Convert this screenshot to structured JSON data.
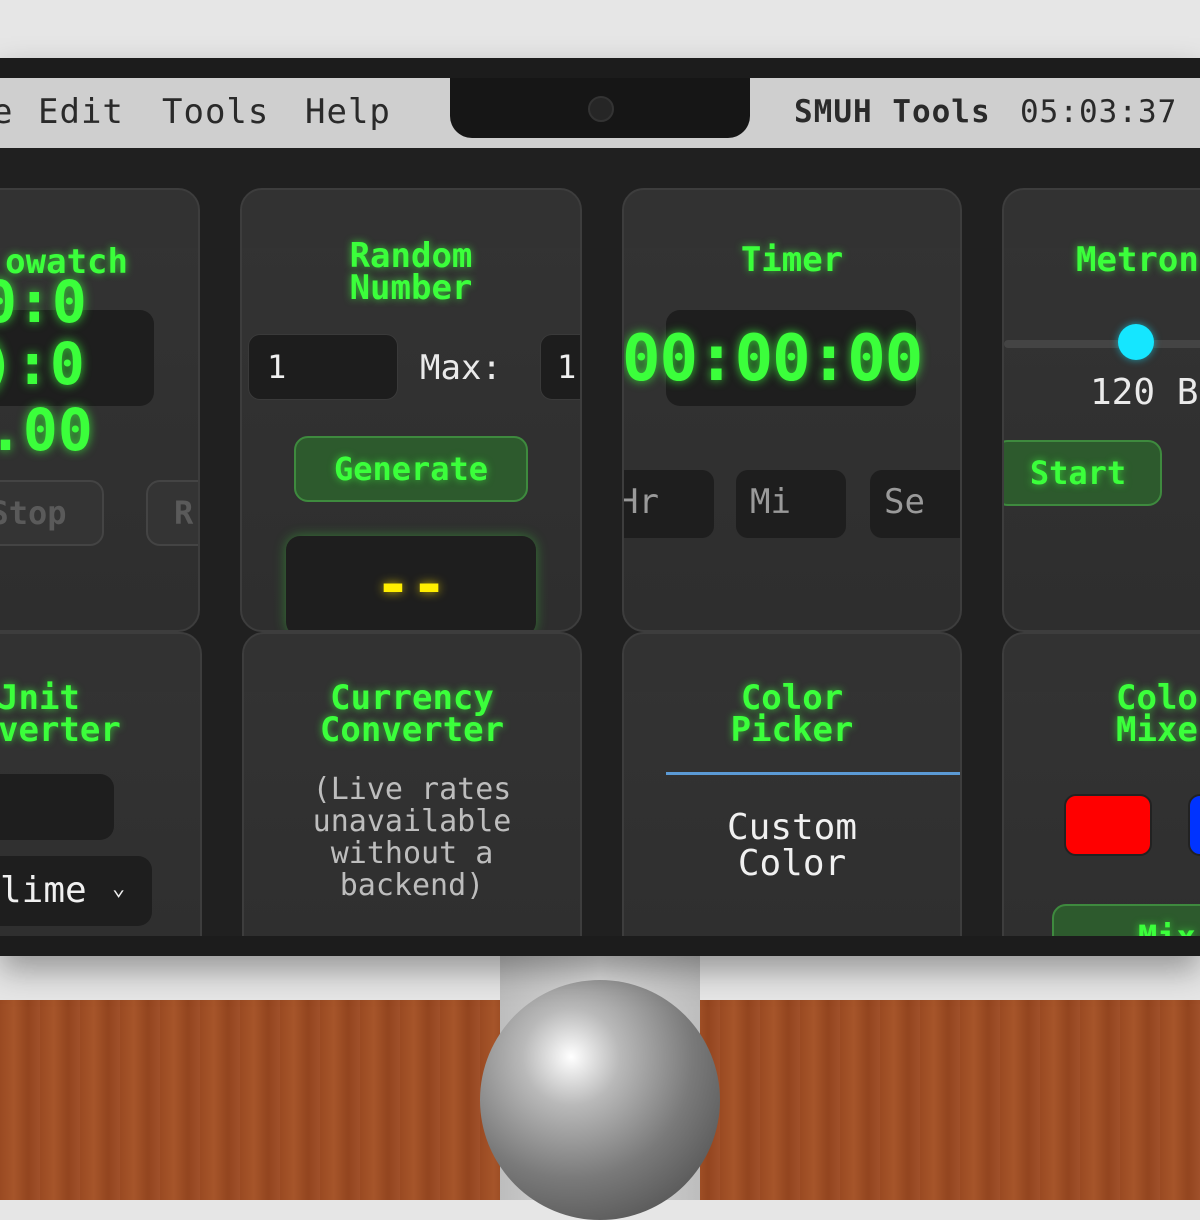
{
  "menubar": {
    "items": [
      "e",
      "Edit",
      "Tools",
      "Help"
    ],
    "brand": "SMUH Tools",
    "clock": "05:03:37"
  },
  "cards": {
    "stopwatch": {
      "title": "owatch",
      "line1": "0:0",
      "line2": "):0",
      "line3": ".00",
      "stop_label": "Stop",
      "reset_label": "R"
    },
    "random": {
      "title_line1": "Random",
      "title_line2": "Number",
      "min_value": "1",
      "max_label": "Max:",
      "max_value": "1",
      "generate_label": "Generate",
      "result": "--"
    },
    "timer": {
      "title": "Timer",
      "display": "00:00:00",
      "hr_placeholder": "Hr",
      "mi_placeholder": "Mi",
      "se_placeholder": "Se"
    },
    "metronome": {
      "title": "Metron",
      "bpm": "120 B",
      "start_label": "Start",
      "slider_value": 0.3
    },
    "unit": {
      "title_line1": "Jnit",
      "title_line2": "verter",
      "select_value": "lime"
    },
    "currency": {
      "title_line1": "Currency",
      "title_line2": "Converter",
      "note_line1": "(Live rates",
      "note_line2": "unavailable",
      "note_line3": "without a",
      "note_line4": "backend)"
    },
    "colorpicker": {
      "title_line1": "Color",
      "title_line2": "Picker",
      "custom_line1": "Custom",
      "custom_line2": "Color"
    },
    "colormixer": {
      "title_line1": "Colo",
      "title_line2": "Mixe",
      "color_a": "#ff0000",
      "color_b": "#0033ff",
      "mix_label": "Mix"
    }
  }
}
